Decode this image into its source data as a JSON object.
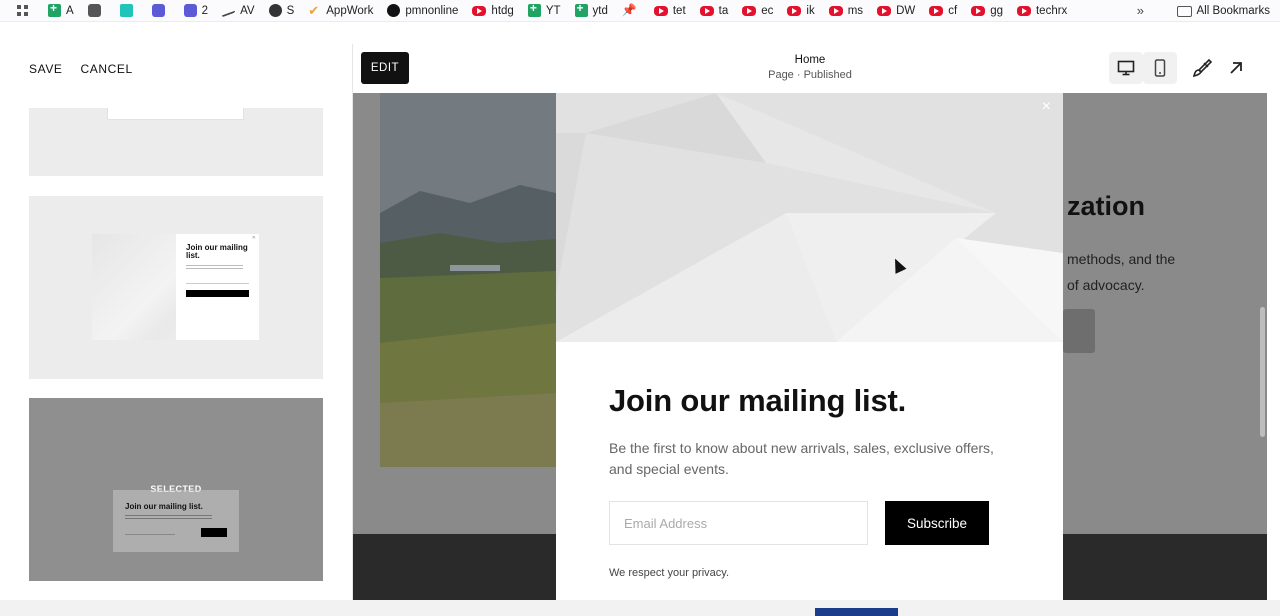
{
  "bookmarks_bar": {
    "items": [
      {
        "label": "A",
        "icon": "sheets-icon"
      },
      {
        "label": "",
        "icon": "puzzle-icon"
      },
      {
        "label": "",
        "icon": "teal-app-icon"
      },
      {
        "label": "",
        "icon": "chat-icon"
      },
      {
        "label": "2",
        "icon": "chat-icon"
      },
      {
        "label": "AV",
        "icon": "trend-icon"
      },
      {
        "label": "S",
        "icon": "globe-icon"
      },
      {
        "label": "AppWork",
        "icon": "check-icon"
      },
      {
        "label": "pmnonline",
        "icon": "github-icon"
      },
      {
        "label": "htdg",
        "icon": "youtube-icon"
      },
      {
        "label": "YT",
        "icon": "sheets-icon"
      },
      {
        "label": "ytd",
        "icon": "sheets-icon"
      },
      {
        "label": "",
        "icon": "pin-icon"
      },
      {
        "label": "tet",
        "icon": "youtube-icon"
      },
      {
        "label": "ta",
        "icon": "youtube-icon"
      },
      {
        "label": "ec",
        "icon": "youtube-icon"
      },
      {
        "label": "ik",
        "icon": "youtube-icon"
      },
      {
        "label": "ms",
        "icon": "youtube-icon"
      },
      {
        "label": "DW",
        "icon": "youtube-icon"
      },
      {
        "label": "cf",
        "icon": "youtube-icon"
      },
      {
        "label": "gg",
        "icon": "youtube-icon"
      },
      {
        "label": "techrx",
        "icon": "youtube-icon"
      }
    ],
    "more_label": "»",
    "all_bookmarks": "All Bookmarks"
  },
  "left_panel": {
    "save_label": "SAVE",
    "cancel_label": "CANCEL",
    "thumb2_title": "Join our mailing list.",
    "selected_label": "SELECTED",
    "thumb3_title": "Join our mailing list."
  },
  "preview_header": {
    "edit_label": "EDIT",
    "page_title": "Home",
    "page_subtitle": "Page · Published"
  },
  "site_background": {
    "heading_fragment": "zation",
    "line1": "methods, and the",
    "line2": "of advocacy."
  },
  "popup": {
    "close_label": "×",
    "title": "Join our mailing list.",
    "description": "Be the first to know about new arrivals, sales, exclusive offers, and special events.",
    "email_placeholder": "Email Address",
    "subscribe_label": "Subscribe",
    "privacy": "We respect your privacy."
  },
  "colors": {
    "accent_dark": "#000000",
    "overlay_gray": "#8a8a8a",
    "footer_dark": "#2a2a2a"
  }
}
